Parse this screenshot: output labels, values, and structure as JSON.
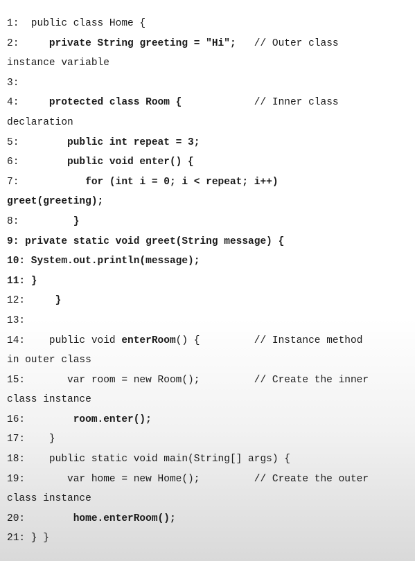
{
  "document": {
    "lines": [
      {
        "segments": [
          {
            "text": "1:  public class Home {",
            "bold": false
          }
        ]
      },
      {
        "segments": [
          {
            "text": "2:     ",
            "bold": false
          },
          {
            "text": "private String greeting = \"Hi\";",
            "bold": true
          },
          {
            "text": "   // Outer class",
            "bold": false
          }
        ]
      },
      {
        "segments": [
          {
            "text": "instance variable",
            "bold": false
          }
        ]
      },
      {
        "segments": [
          {
            "text": "3:",
            "bold": false
          }
        ]
      },
      {
        "segments": [
          {
            "text": "4:     ",
            "bold": false
          },
          {
            "text": "protected class Room {",
            "bold": true
          },
          {
            "text": "            // Inner class",
            "bold": false
          }
        ]
      },
      {
        "segments": [
          {
            "text": "declaration",
            "bold": false
          }
        ]
      },
      {
        "segments": [
          {
            "text": "5:        ",
            "bold": false
          },
          {
            "text": "public int repeat = 3;",
            "bold": true
          }
        ]
      },
      {
        "segments": [
          {
            "text": "6:        ",
            "bold": false
          },
          {
            "text": "public void enter() {",
            "bold": true
          }
        ]
      },
      {
        "segments": [
          {
            "text": "7:           ",
            "bold": false
          },
          {
            "text": "for (int i = 0; i < repeat; i++)",
            "bold": true
          }
        ]
      },
      {
        "segments": [
          {
            "text": "greet(greeting);",
            "bold": true
          }
        ]
      },
      {
        "segments": [
          {
            "text": "8:         ",
            "bold": false
          },
          {
            "text": "}",
            "bold": true
          }
        ]
      },
      {
        "segments": [
          {
            "text": "9: private static void greet(String message) {",
            "bold": true
          }
        ]
      },
      {
        "segments": [
          {
            "text": "10: System.out.println(message);",
            "bold": true
          }
        ]
      },
      {
        "segments": [
          {
            "text": "11: }",
            "bold": true
          }
        ]
      },
      {
        "segments": [
          {
            "text": "12:     ",
            "bold": false
          },
          {
            "text": "}",
            "bold": true
          }
        ]
      },
      {
        "segments": [
          {
            "text": "13:",
            "bold": false
          }
        ]
      },
      {
        "segments": [
          {
            "text": "14:    public void ",
            "bold": false
          },
          {
            "text": "enterRoom",
            "bold": true
          },
          {
            "text": "() {         // Instance method",
            "bold": false
          }
        ]
      },
      {
        "segments": [
          {
            "text": "in outer class",
            "bold": false
          }
        ]
      },
      {
        "segments": [
          {
            "text": "15:       var room = new Room();         // Create the inner",
            "bold": false
          }
        ]
      },
      {
        "segments": [
          {
            "text": "class instance",
            "bold": false
          }
        ]
      },
      {
        "segments": [
          {
            "text": "16:        ",
            "bold": false
          },
          {
            "text": "room.enter();",
            "bold": true
          }
        ]
      },
      {
        "segments": [
          {
            "text": "17:    }",
            "bold": false
          }
        ]
      },
      {
        "segments": [
          {
            "text": "18:    public static void main(String[] args) {",
            "bold": false
          }
        ]
      },
      {
        "segments": [
          {
            "text": "19:       var home = new Home();         // Create the outer",
            "bold": false
          }
        ]
      },
      {
        "segments": [
          {
            "text": "class instance",
            "bold": false
          }
        ]
      },
      {
        "segments": [
          {
            "text": "20:        ",
            "bold": false
          },
          {
            "text": "home.enterRoom();",
            "bold": true
          }
        ]
      },
      {
        "segments": [
          {
            "text": "21: } }",
            "bold": false
          }
        ]
      }
    ]
  }
}
